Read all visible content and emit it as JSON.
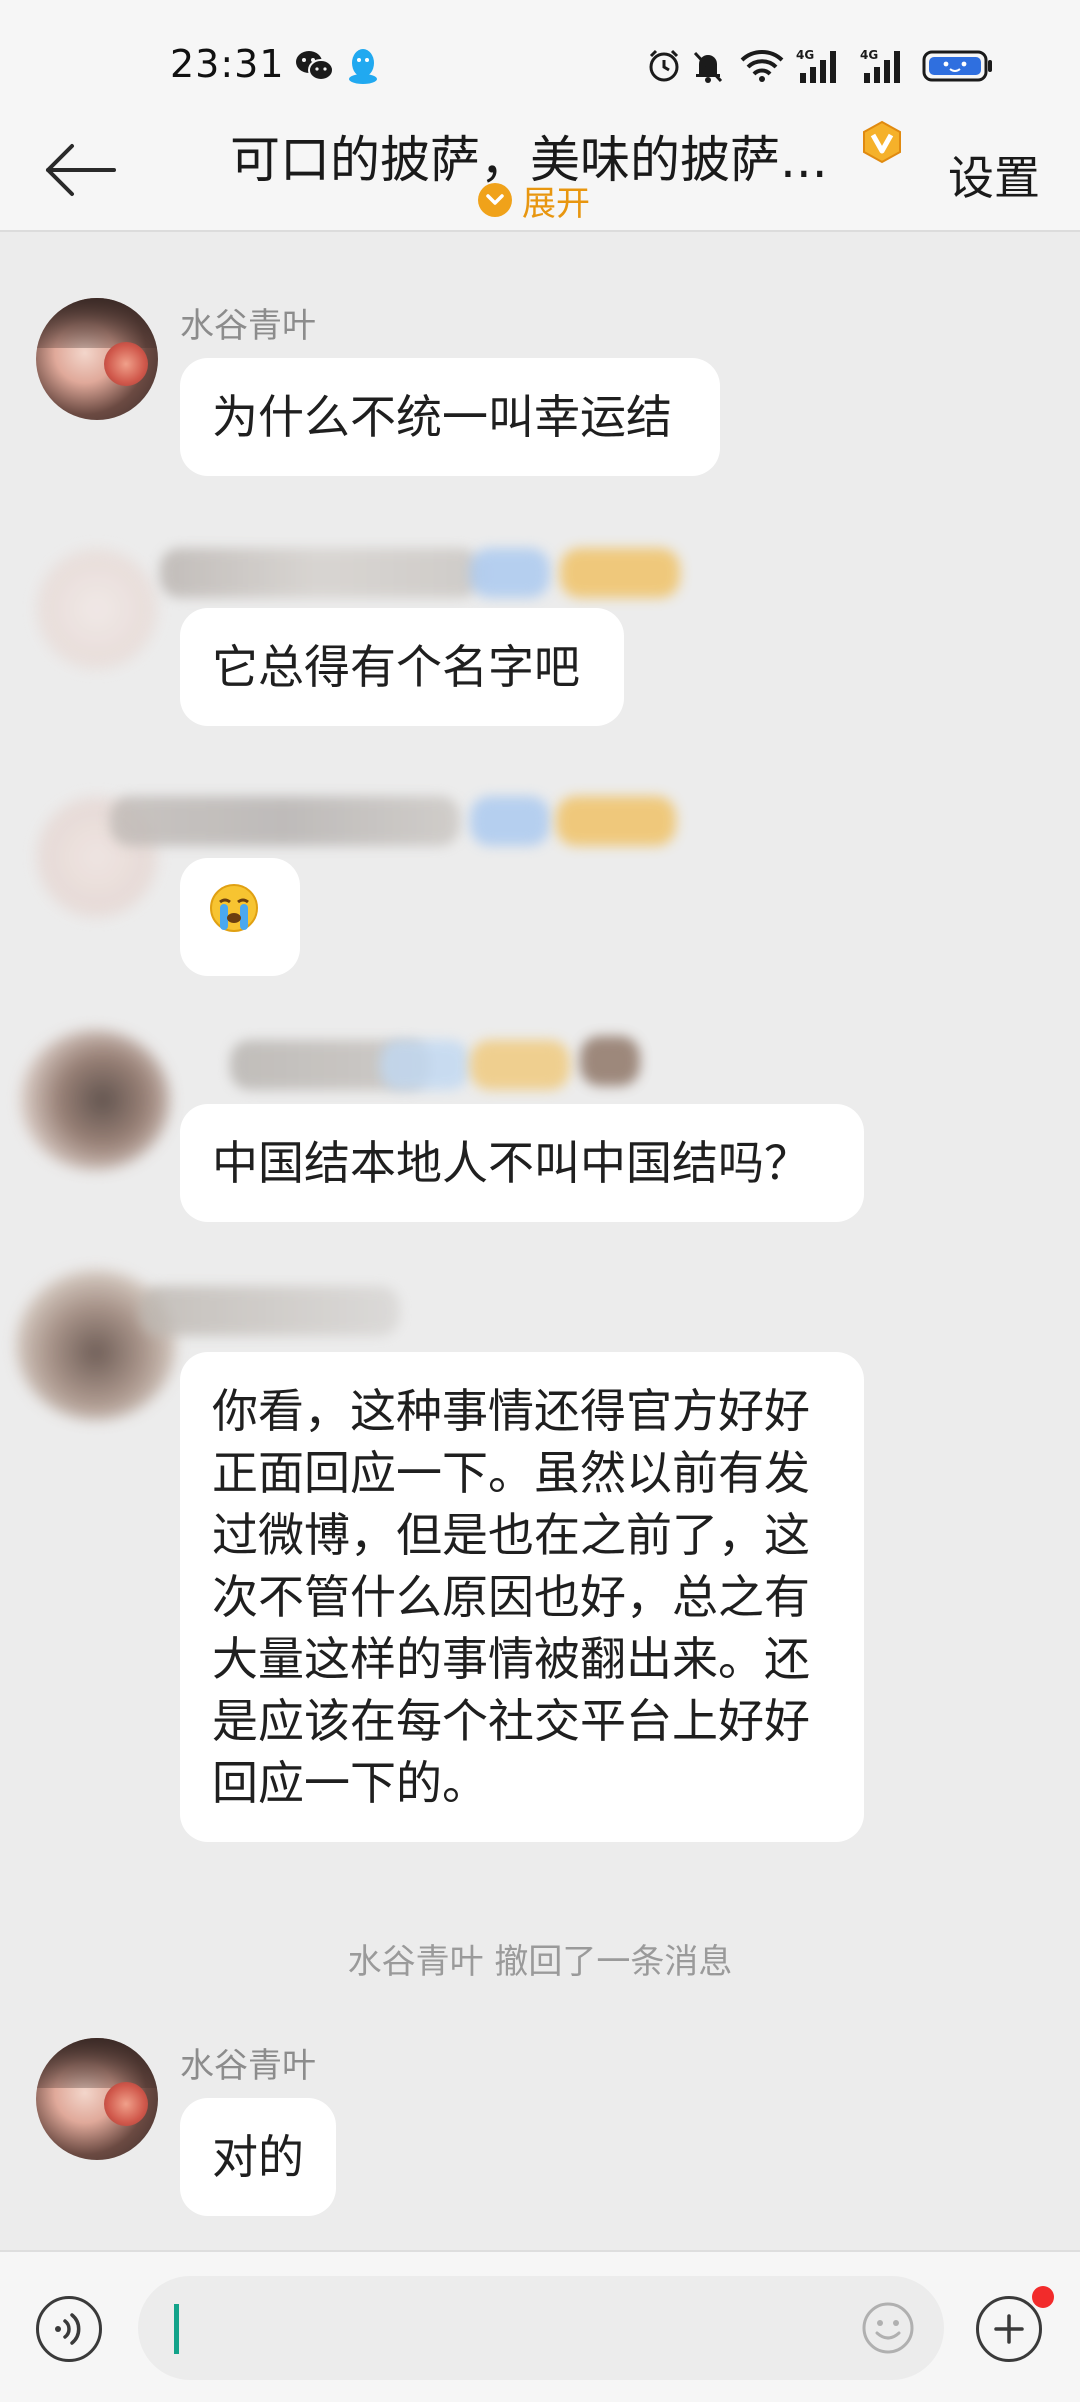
{
  "status_bar": {
    "time": "23:31",
    "network_label_1": "4G",
    "network_label_2": "4G"
  },
  "header": {
    "title": "可口的披萨，美味的披萨...",
    "expand_label": "展开",
    "settings_label": "设置"
  },
  "messages": [
    {
      "sender": "水谷青叶",
      "text": "为什么不统一叫幸运结"
    },
    {
      "sender": "",
      "text": "它总得有个名字吧"
    },
    {
      "sender": "",
      "text": "😭"
    },
    {
      "sender": "",
      "text": "中国结本地人不叫中国结吗？"
    },
    {
      "sender": "",
      "lines": [
        "你看，这种事情还得官方好好",
        "正面回应一下。虽然以前有发",
        "过微博，但是也在之前了，这",
        "次不管什么原因也好，总之有",
        "大量这样的事情被翻出来。还",
        "是应该在每个社交平台上好好",
        "回应一下的。"
      ]
    },
    {
      "sender": "水谷青叶",
      "text": "对的"
    }
  ],
  "recall_note": "水谷青叶 撤回了一条消息",
  "input": {
    "value": ""
  },
  "colors": {
    "accent_orange": "#f0a21a",
    "caret_green": "#13a38a",
    "notification_red": "#f22b2b"
  },
  "icons": [
    "back-arrow-icon",
    "wechat-icon",
    "qq-icon",
    "alarm-icon",
    "mute-icon",
    "wifi-icon",
    "signal-icon",
    "battery-icon",
    "vip-badge-icon",
    "chevron-down-icon",
    "voice-icon",
    "emoji-icon",
    "plus-icon"
  ]
}
